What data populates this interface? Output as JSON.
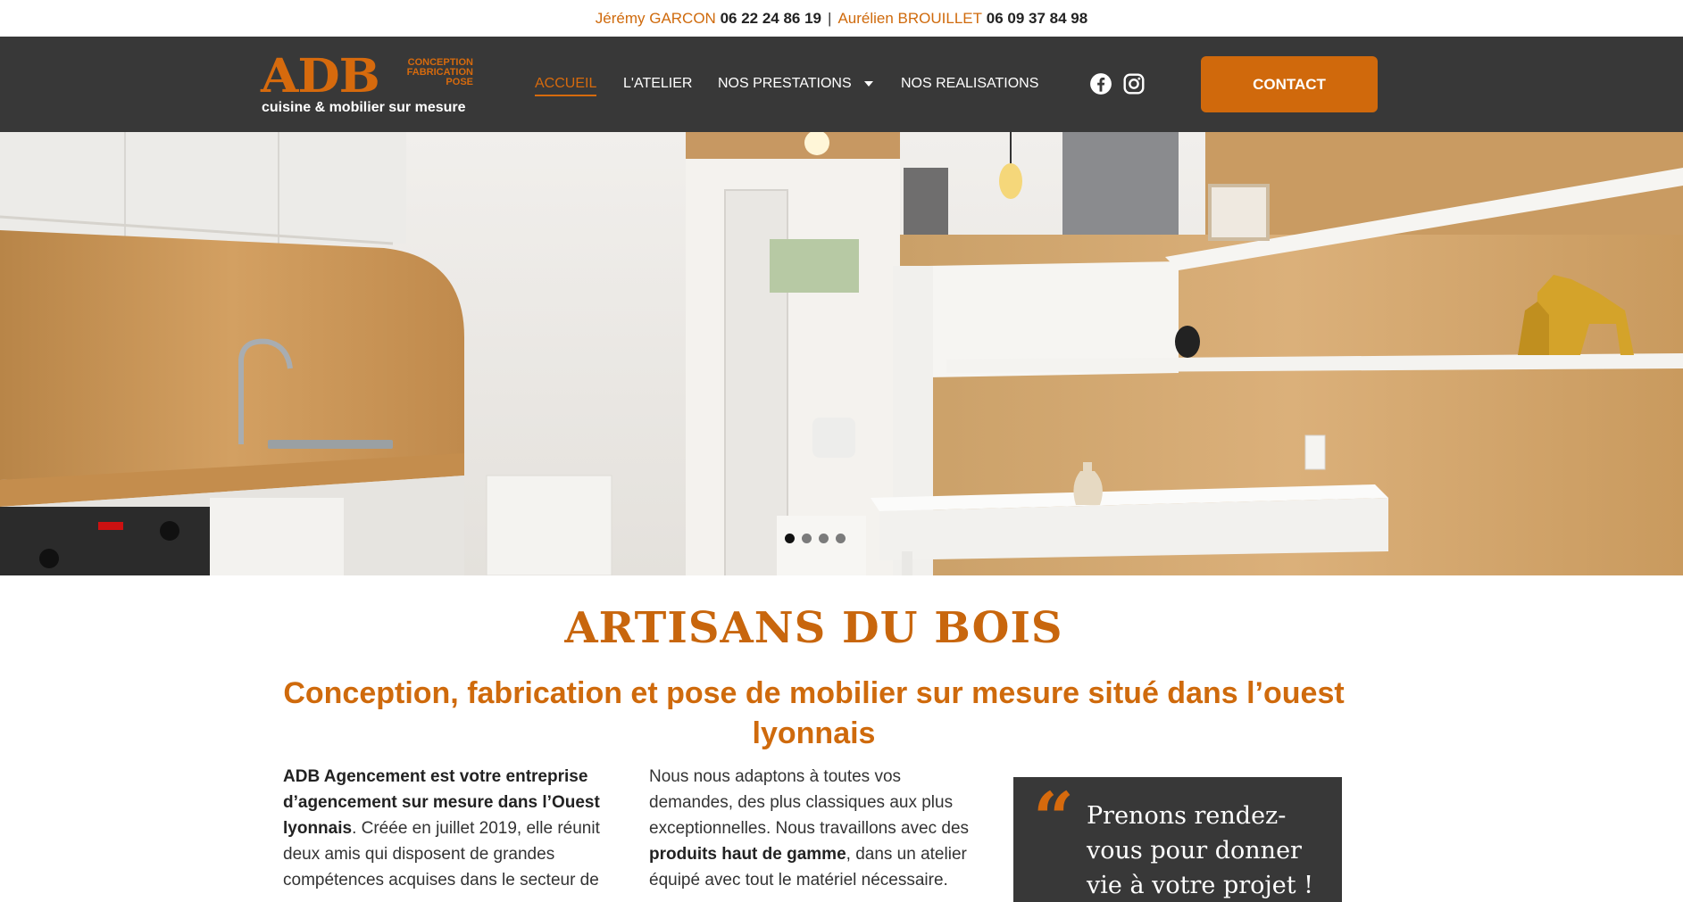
{
  "topbar": {
    "name1": "Jérémy GARCON",
    "phone1": "06 22 24 86 19",
    "separator": "|",
    "name2": "Aurélien BROUILLET",
    "phone2": "06 09 37 84 98"
  },
  "logo": {
    "mark": "ADB",
    "tag1": "CONCEPTION",
    "tag2": "FABRICATION",
    "tag3": "POSE",
    "tagline": "cuisine & mobilier sur mesure"
  },
  "nav": {
    "items": [
      {
        "label": "ACCUEIL",
        "active": true
      },
      {
        "label": "L'ATELIER",
        "active": false
      },
      {
        "label": "NOS PRESTATIONS",
        "active": false,
        "dropdown": true
      },
      {
        "label": "NOS REALISATIONS",
        "active": false
      }
    ],
    "social": [
      {
        "icon": "facebook-icon"
      },
      {
        "icon": "instagram-icon"
      }
    ],
    "contact_label": "CONTACT"
  },
  "hero": {
    "slides": 4,
    "active_slide": 0
  },
  "content": {
    "title": "ARTISANS DU BOIS",
    "subtitle": "Conception, fabrication et pose de mobilier sur mesure situé dans l’ouest lyonnais",
    "col1_bold": "ADB Agencement est votre entreprise d’agencement sur mesure dans l’Ouest lyonnais",
    "col1_text": ". Créée en juillet 2019, elle réunit deux amis qui disposent de grandes compétences acquises dans le secteur de",
    "col2_text1": "Nous nous adaptons à toutes vos demandes, des plus classiques aux plus exceptionnelles. Nous travaillons avec des ",
    "col2_bold": "produits haut de gamme",
    "col2_text2": ", dans un atelier équipé avec tout le matériel nécessaire.",
    "quote_mark": "“",
    "quote": "Prenons rendez-vous pour donner vie à votre projet !"
  },
  "colors": {
    "accent": "#d0690c",
    "header_bg": "#383838"
  }
}
